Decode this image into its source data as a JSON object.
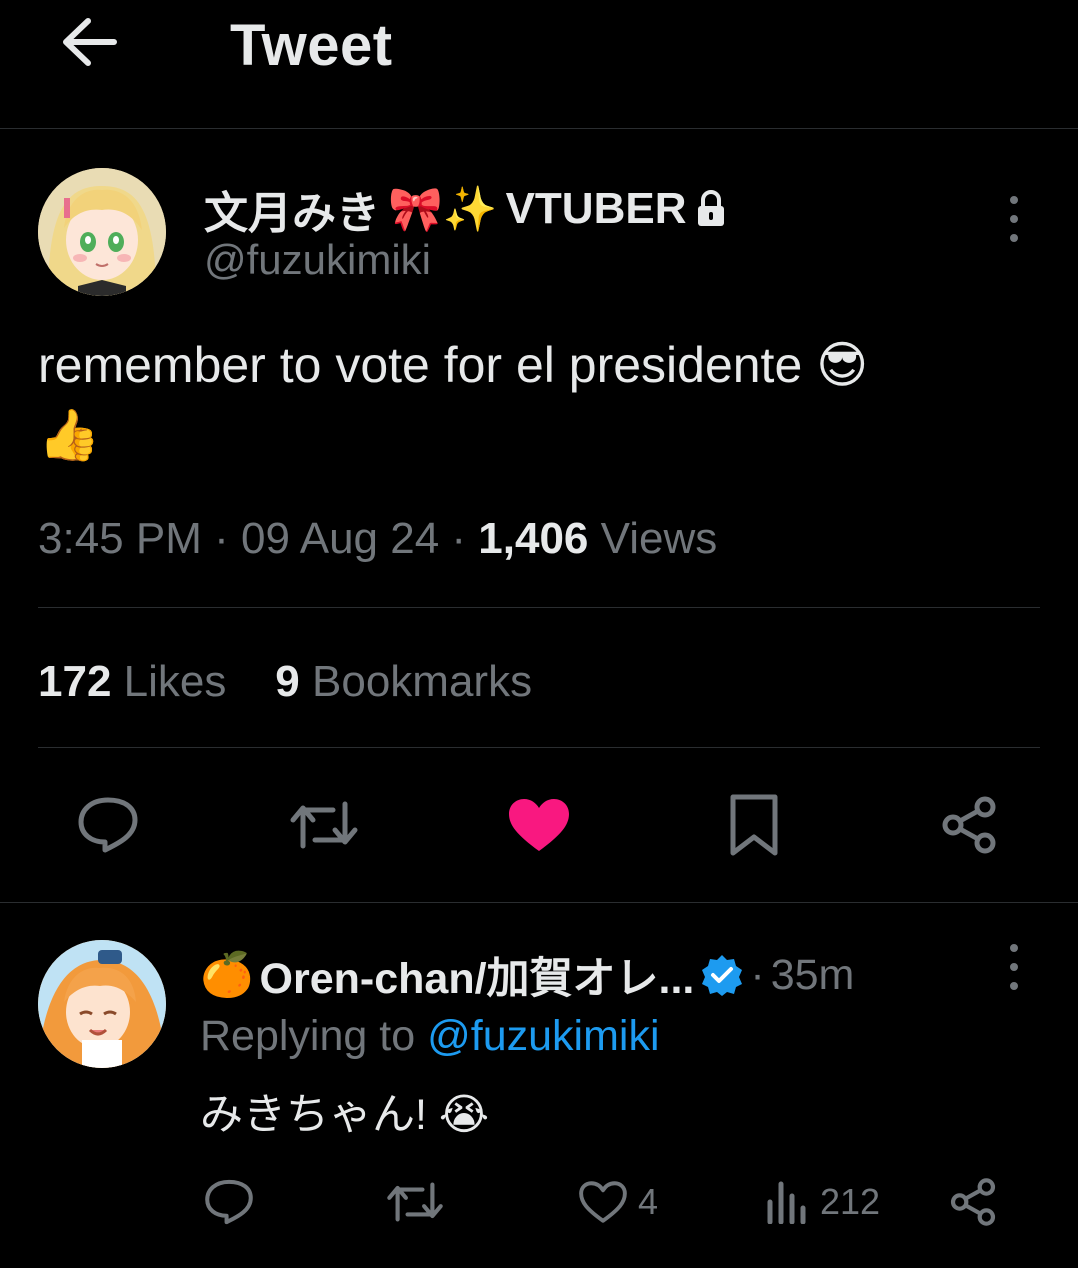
{
  "header": {
    "title": "Tweet",
    "back_icon": "arrow-left-icon"
  },
  "tweet": {
    "author_name": "文月みき",
    "author_emojis": "🎀✨",
    "author_tag": "VTUBER",
    "lock_icon": "lock-icon",
    "handle": "@fuzukimiki",
    "text": "remember to vote for el presidente",
    "text_emoji_1": "😎",
    "text_emoji_2": "👍",
    "time": "3:45 PM",
    "date": "09 Aug 24",
    "views_count": "1,406",
    "views_label": "Views",
    "likes_count": "172",
    "likes_label": "Likes",
    "bookmarks_count": "9",
    "bookmarks_label": "Bookmarks",
    "actions": [
      "reply-icon",
      "retweet-icon",
      "heart-filled-icon",
      "bookmark-icon",
      "share-icon"
    ]
  },
  "reply": {
    "author_prefix_emoji": "🍊",
    "author_name": "Oren-chan/加賀オレ...",
    "verified_icon": "verified-badge-icon",
    "time": "35m",
    "replying_label": "Replying to",
    "replying_handle": "@fuzukimiki",
    "text": "みきちゃん!",
    "text_emoji": "😭",
    "like_count": "4",
    "views_count": "212"
  },
  "colors": {
    "background": "#000000",
    "text": "#e7e9ea",
    "muted": "#71767b",
    "accent_blue": "#1d9bf0",
    "like_pink": "#f91880"
  }
}
